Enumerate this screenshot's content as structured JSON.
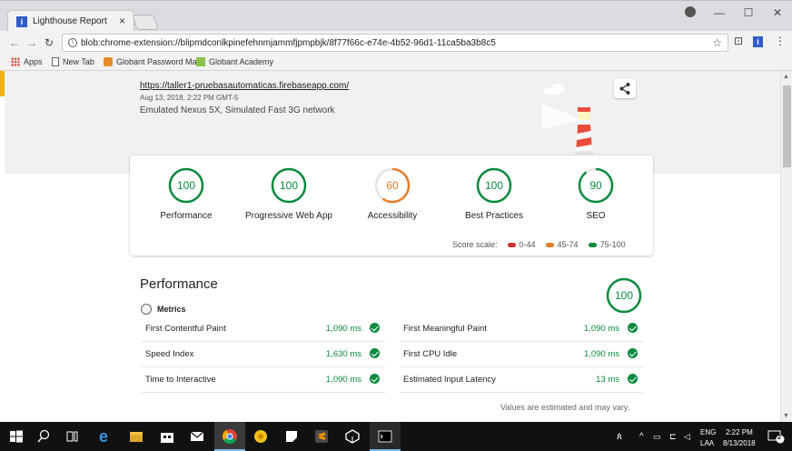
{
  "browser": {
    "tab_title": "Lighthouse Report",
    "tab_close": "×",
    "url": "blob:chrome-extension://blipmdconlkpinefehnmjammfjpmpbjk/8f77f66c-e74e-4b52-96d1-11ca5ba3b8c5",
    "window_controls": {
      "minimize": "—",
      "maximize": "☐",
      "close": "✕"
    },
    "bookmarks": [
      {
        "label": "Apps"
      },
      {
        "label": "New Tab"
      },
      {
        "label": "Globant Password Ma"
      },
      {
        "label": "Globant Academy"
      }
    ]
  },
  "report": {
    "url": "https://taller1-pruebasautomaticas.firebaseapp.com/",
    "date": "Aug 13, 2018, 2:22 PM GMT-5",
    "environment": "Emulated Nexus 5X, Simulated Fast 3G network"
  },
  "scores": [
    {
      "value": "100",
      "label": "Performance",
      "fraction": 1.0,
      "color": "#0b8a3e"
    },
    {
      "value": "100",
      "label": "Progressive Web App",
      "fraction": 1.0,
      "color": "#0b8a3e"
    },
    {
      "value": "60",
      "label": "Accessibility",
      "fraction": 0.6,
      "color": "#e67d2a"
    },
    {
      "value": "100",
      "label": "Best Practices",
      "fraction": 1.0,
      "color": "#0b8a3e"
    },
    {
      "value": "90",
      "label": "SEO",
      "fraction": 0.9,
      "color": "#0b8a3e"
    }
  ],
  "score_scale": {
    "label": "Score scale:",
    "ranges": [
      {
        "label": "0-44",
        "color": "#d0312d"
      },
      {
        "label": "45-74",
        "color": "#e67d2a"
      },
      {
        "label": "75-100",
        "color": "#0b8a3e"
      }
    ]
  },
  "performance": {
    "title": "Performance",
    "score": "100",
    "metrics_label": "Metrics",
    "metrics": [
      {
        "name": "First Contentful Paint",
        "value": "1,090 ms"
      },
      {
        "name": "First Meaningful Paint",
        "value": "1,090 ms"
      },
      {
        "name": "Speed Index",
        "value": "1,630 ms"
      },
      {
        "name": "First CPU Idle",
        "value": "1,090 ms"
      },
      {
        "name": "Time to Interactive",
        "value": "1,090 ms"
      },
      {
        "name": "Estimated Input Latency",
        "value": "13 ms"
      }
    ],
    "note": "Values are estimated and may vary."
  },
  "taskbar": {
    "lang": "ENG",
    "layout": "LAA",
    "time": "2:22 PM",
    "date": "8/13/2018",
    "notifications": "2"
  }
}
